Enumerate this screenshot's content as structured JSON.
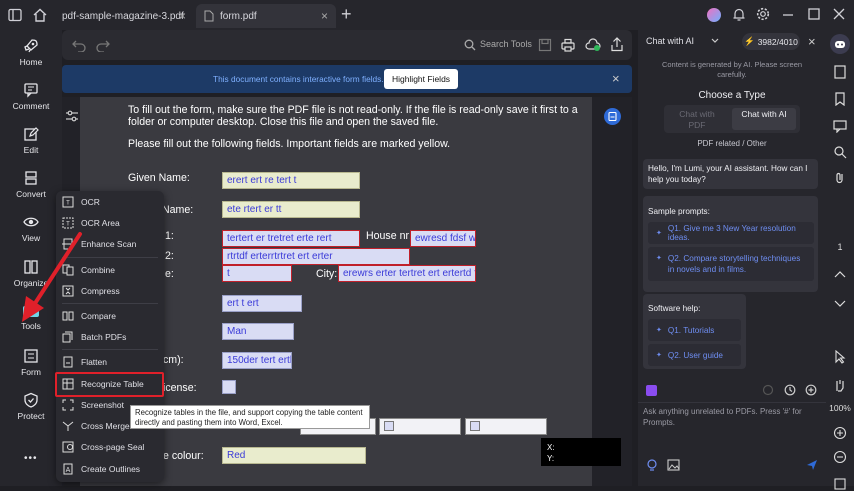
{
  "tabs": [
    {
      "label": "pdf-sample-magazine-3.pdf",
      "close": "×"
    },
    {
      "label": "form.pdf",
      "close": "×"
    }
  ],
  "new_tab": "+",
  "left_sidebar": [
    {
      "label": "Home",
      "icon": "rocket-icon"
    },
    {
      "label": "Comment",
      "icon": "comment-icon"
    },
    {
      "label": "Edit",
      "icon": "edit-icon"
    },
    {
      "label": "Convert",
      "icon": "convert-icon"
    },
    {
      "label": "View",
      "icon": "eye-icon"
    },
    {
      "label": "Organize",
      "icon": "organize-icon"
    },
    {
      "label": "Tools",
      "icon": "tools-icon"
    },
    {
      "label": "Form",
      "icon": "form-icon"
    },
    {
      "label": "Protect",
      "icon": "shield-icon"
    }
  ],
  "more": "•••",
  "toolbar": {
    "search_placeholder": "Search Tools"
  },
  "banner": {
    "text": "This document contains interactive form fields.",
    "button": "Highlight Fields",
    "close": "×"
  },
  "document": {
    "intro": [
      "To fill out the form, make sure the PDF file is not read-only. If the file is read-only save it first to a",
      "folder or computer desktop. Close this file and open the saved file."
    ],
    "instructions": "Please fill out the following fields. Important fields are marked yellow.",
    "labels": {
      "given_name": "Given Name:",
      "family_name": "Name:",
      "address1": "1:",
      "address2": "2:",
      "postcode": "e:",
      "house_nr": "House nr:",
      "city": "City:",
      "height": "cm):",
      "license": "icense:",
      "colour": "e colour:"
    },
    "fields": {
      "given_name": "erert ert re tert t",
      "family_name": "ete rtert er tt",
      "address1": "tertert er tretret  erte rert",
      "house_nr": "ewresd fdsf w",
      "address2": "rtrtdf erterrtrtret ert erter",
      "postcode": "t",
      "city": "erewrs erter tertret ert ertertd fr",
      "country": "ert t ert",
      "gender": "Man",
      "height": "150der tert ertl",
      "colour": "Red"
    }
  },
  "tools_menu": [
    {
      "label": "OCR",
      "icon": "ocr-icon"
    },
    {
      "label": "OCR Area",
      "icon": "ocr-area-icon"
    },
    {
      "label": "Enhance Scan",
      "icon": "enhance-scan-icon"
    },
    {
      "label": "Combine",
      "icon": "combine-icon"
    },
    {
      "label": "Compress",
      "icon": "compress-icon"
    },
    {
      "label": "Compare",
      "icon": "compare-icon"
    },
    {
      "label": "Batch PDFs",
      "icon": "batch-icon"
    },
    {
      "label": "Flatten",
      "icon": "flatten-icon"
    },
    {
      "label": "Recognize Table",
      "icon": "table-icon"
    },
    {
      "label": "Screenshot",
      "icon": "screenshot-icon"
    },
    {
      "label": "Cross Merge",
      "icon": "cross-merge-icon"
    },
    {
      "label": "Cross-page Seal",
      "icon": "seal-icon"
    },
    {
      "label": "Create Outlines",
      "icon": "outline-icon"
    }
  ],
  "tooltip": "Recognize tables in the file, and support copying the table content directly and pasting them into Word, Excel.",
  "coords": {
    "x": "X:",
    "y": "Y:"
  },
  "chat": {
    "mode": "Chat with AI",
    "credits": "3982/4010",
    "disclaimer": "Content is generated by AI. Please screen carefully.",
    "choose_type": "Choose a Type",
    "type_pdf": "Chat with PDF",
    "type_ai": "Chat with AI",
    "subtitle": "PDF related / Other",
    "greeting": "Hello, I'm Lumi, your AI assistant. How can I help you today?",
    "sample_title": "Sample prompts:",
    "sample_prompts": [
      "Q1. Give me 3 New Year resolution ideas.",
      "Q2. Compare storytelling techniques in novels and in films."
    ],
    "help_title": "Software help:",
    "help_prompts": [
      "Q1. Tutorials",
      "Q2. User guide"
    ],
    "input_placeholder": "Ask anything unrelated to PDFs. Press '#' for Prompts."
  },
  "right_sidebar": {
    "page": "1",
    "zoom": "100%"
  },
  "colors": {
    "accent": "#2f6bd8",
    "highlight_red": "#e0202a",
    "link": "#6f8ef2"
  }
}
